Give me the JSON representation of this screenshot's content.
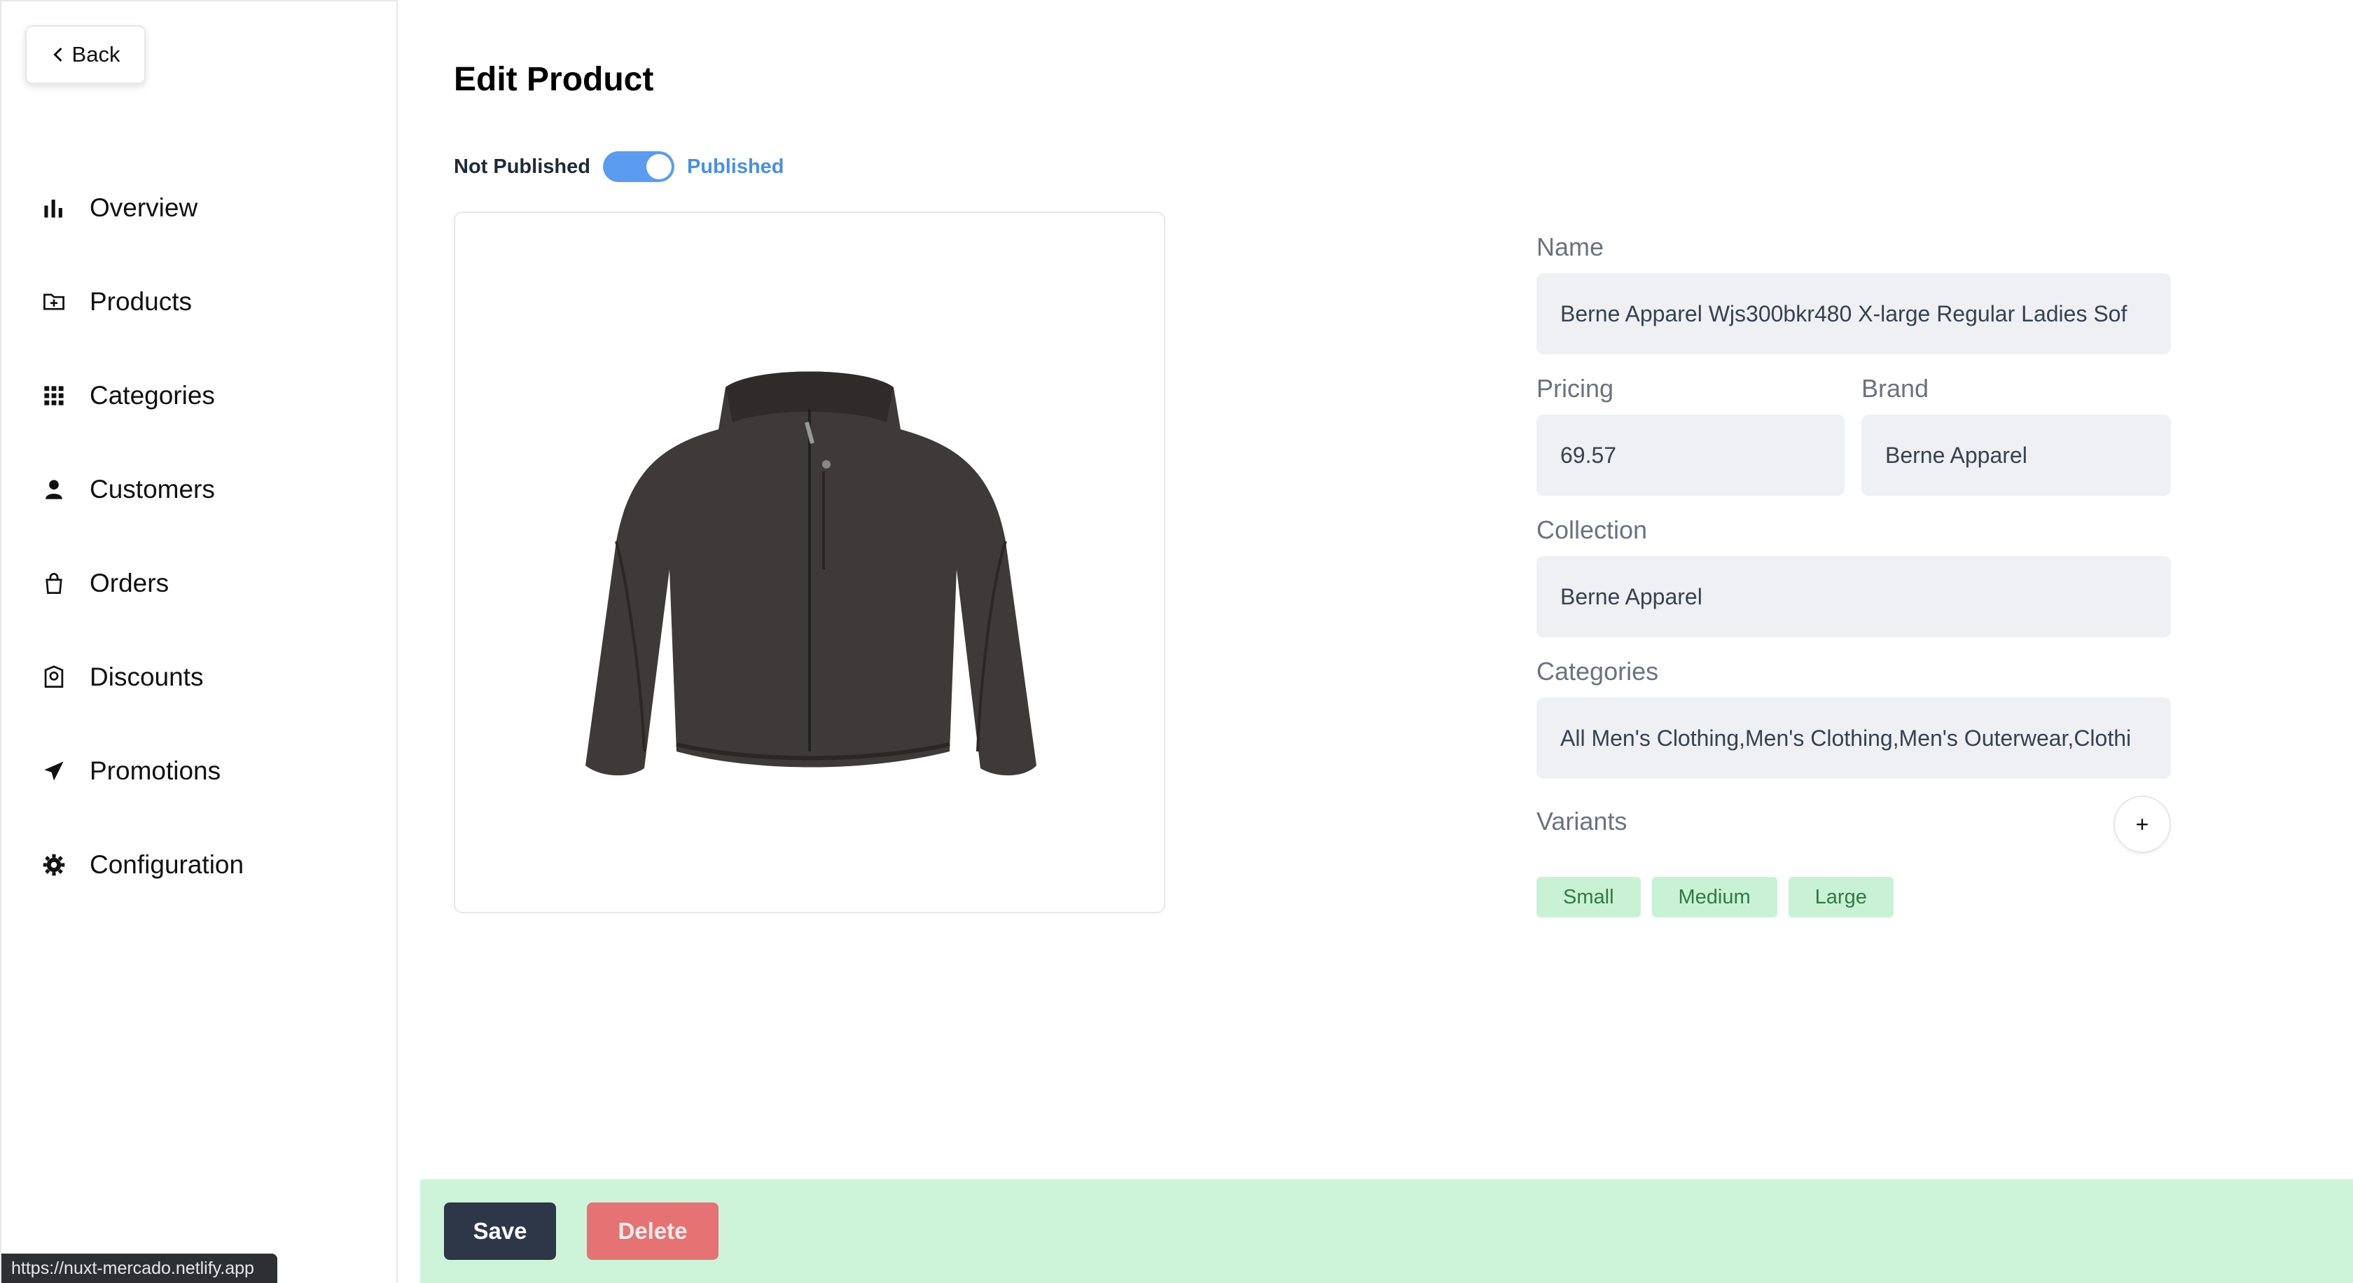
{
  "sidebar": {
    "back_label": "Back",
    "items": [
      {
        "label": "Overview",
        "icon": "bar-chart-icon"
      },
      {
        "label": "Products",
        "icon": "folder-plus-icon"
      },
      {
        "label": "Categories",
        "icon": "grid-icon"
      },
      {
        "label": "Customers",
        "icon": "user-icon"
      },
      {
        "label": "Orders",
        "icon": "shopping-bag-icon"
      },
      {
        "label": "Discounts",
        "icon": "badge-icon"
      },
      {
        "label": "Promotions",
        "icon": "paper-plane-icon"
      },
      {
        "label": "Configuration",
        "icon": "gear-icon"
      }
    ]
  },
  "status_url": "https://nuxt-mercado.netlify.app",
  "main": {
    "title": "Edit Product",
    "publish": {
      "off_label": "Not Published",
      "on_label": "Published",
      "state": "published"
    }
  },
  "form": {
    "name_label": "Name",
    "name_value": "Berne Apparel Wjs300bkr480 X-large Regular Ladies Sof",
    "pricing_label": "Pricing",
    "pricing_value": "69.57",
    "brand_label": "Brand",
    "brand_value": "Berne Apparel",
    "collection_label": "Collection",
    "collection_value": "Berne Apparel",
    "categories_label": "Categories",
    "categories_value": "All Men's Clothing,Men's Clothing,Men's Outerwear,Clothi",
    "variants_label": "Variants",
    "add_variant_label": "+",
    "variants": [
      "Small",
      "Medium",
      "Large"
    ]
  },
  "actions": {
    "save_label": "Save",
    "delete_label": "Delete"
  },
  "colors": {
    "accent": "#5b9cf0",
    "bar": "#cdf4d8",
    "save": "#2d3748",
    "delete": "#e57373",
    "chip": "#c9f2d5"
  }
}
